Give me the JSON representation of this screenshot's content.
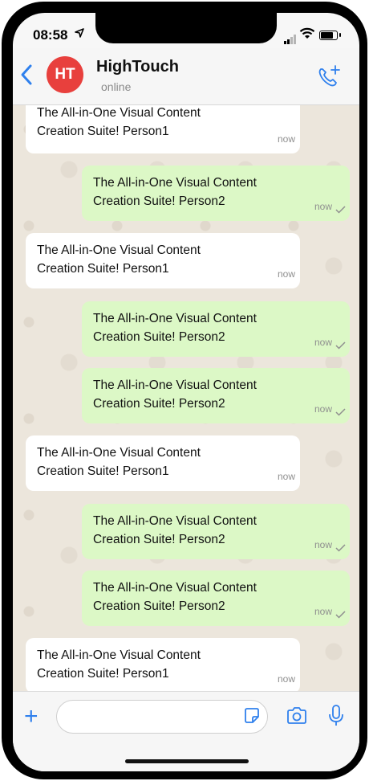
{
  "status_bar": {
    "time": "08:58"
  },
  "header": {
    "avatar_initials": "HT",
    "contact_name": "HighTouch",
    "presence": "online",
    "accent_color": "#2f80ed",
    "avatar_color": "#e8403d"
  },
  "messages": [
    {
      "direction": "in",
      "text": "The All-in-One Visual Content Creation Suite! Person1",
      "time": "now"
    },
    {
      "direction": "out",
      "text": "The All-in-One Visual Content Creation Suite! Person2",
      "time": "now"
    },
    {
      "direction": "in",
      "text": "The All-in-One Visual Content Creation Suite! Person1",
      "time": "now"
    },
    {
      "direction": "out",
      "text": "The All-in-One Visual Content Creation Suite! Person2",
      "time": "now"
    },
    {
      "direction": "out",
      "text": "The All-in-One Visual Content Creation Suite! Person2",
      "time": "now"
    },
    {
      "direction": "in",
      "text": "The All-in-One Visual Content Creation Suite! Person1",
      "time": "now"
    },
    {
      "direction": "out",
      "text": "The All-in-One Visual Content Creation Suite! Person2",
      "time": "now"
    },
    {
      "direction": "out",
      "text": "The All-in-One Visual Content Creation Suite! Person2",
      "time": "now"
    },
    {
      "direction": "in",
      "text": "The All-in-One Visual Content Creation Suite! Person1",
      "time": "now"
    }
  ],
  "composer": {
    "value": "",
    "placeholder": ""
  },
  "icons": {
    "back": "chevron-left-icon",
    "call": "add-call-icon",
    "attach": "plus-icon",
    "sticker": "sticker-icon",
    "camera": "camera-icon",
    "mic": "microphone-icon"
  }
}
